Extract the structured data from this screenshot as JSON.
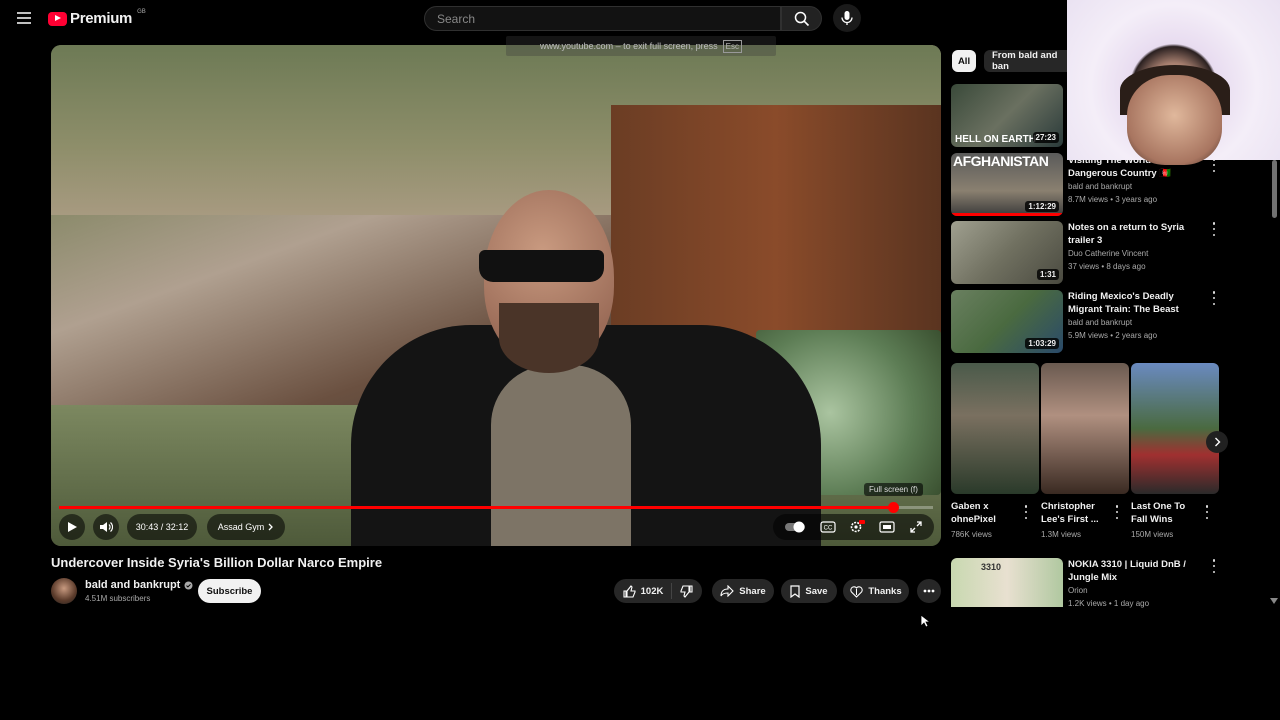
{
  "header": {
    "brand": "Premium",
    "region": "GB",
    "search_placeholder": "Search"
  },
  "player": {
    "fullscreen_notice": "www.youtube.com – to exit full screen, press",
    "esc_key": "Esc",
    "time": "30:43 / 32:12",
    "chapter": "Assad Gym",
    "tooltip": "Full screen (f)",
    "progress_fraction": 0.954
  },
  "video": {
    "title": "Undercover Inside Syria's Billion Dollar Narco Empire",
    "channel": "bald and bankrupt",
    "subscribers": "4.51M subscribers",
    "subscribe_label": "Subscribe",
    "likes": "102K",
    "share": "Share",
    "save": "Save",
    "thanks": "Thanks"
  },
  "chips": [
    "All",
    "From bald and ban"
  ],
  "related": [
    {
      "title": "",
      "meta1": "",
      "meta2": "",
      "duration": "27:23",
      "overlay": "HELL ON EARTH"
    },
    {
      "title": "Visiting The World's Most Dangerous Country 🇦🇫",
      "meta1": "bald and bankrupt",
      "meta2": "8.7M views • 3 years ago",
      "duration": "1:12:29",
      "overlay": "AFGHANISTAN"
    },
    {
      "title": "Notes on a return to Syria trailer 3",
      "meta1": "Duo Catherine Vincent",
      "meta2": "37 views • 8 days ago",
      "duration": "1:31"
    },
    {
      "title": "Riding Mexico's Deadly Migrant Train: The Beast",
      "meta1": "bald and bankrupt",
      "meta2": "5.9M views • 2 years ago",
      "duration": "1:03:29"
    }
  ],
  "shorts": [
    {
      "title": "Gaben x ohnePixel",
      "views": "786K views"
    },
    {
      "title": "Christopher Lee's First ...",
      "views": "1.3M views"
    },
    {
      "title": "Last One To Fall Wins",
      "views": "150M views"
    }
  ],
  "related_bottom": {
    "title": "NOKIA 3310 | Liquid DnB / Jungle Mix",
    "meta1": "Orion",
    "meta2": "1.2K views • 1 day ago",
    "overlay": "3310"
  },
  "colors": {
    "accent": "#ff0000",
    "background": "#000000",
    "chip": "#272727"
  }
}
